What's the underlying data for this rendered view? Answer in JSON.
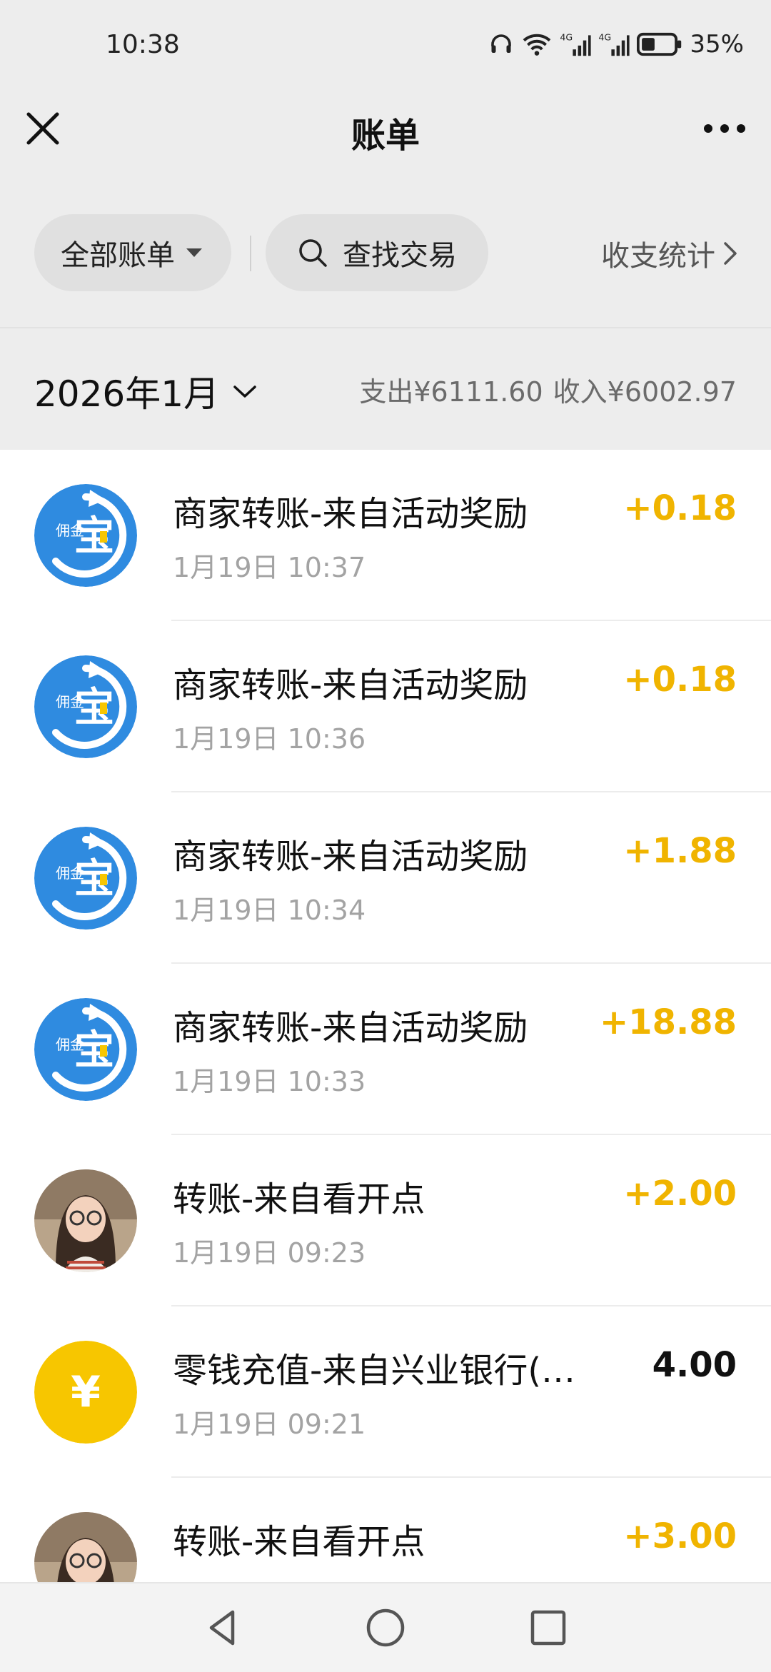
{
  "status_bar": {
    "time": "10:38",
    "battery": "35%"
  },
  "header": {
    "title": "账单"
  },
  "filters": {
    "all_bills": "全部账单",
    "search": "查找交易",
    "stats": "收支统计"
  },
  "month": {
    "label": "2026年1月",
    "expense": "支出¥6111.60",
    "income": "收入¥6002.97"
  },
  "transactions": [
    {
      "title": "商家转账-来自活动奖励",
      "time": "1月19日 10:37",
      "amount": "+0.18",
      "avatar": "yongjinbao-logo"
    },
    {
      "title": "商家转账-来自活动奖励",
      "time": "1月19日 10:36",
      "amount": "+0.18",
      "avatar": "yongjinbao-logo"
    },
    {
      "title": "商家转账-来自活动奖励",
      "time": "1月19日 10:34",
      "amount": "+1.88",
      "avatar": "yongjinbao-logo"
    },
    {
      "title": "商家转账-来自活动奖励",
      "time": "1月19日 10:33",
      "amount": "+18.88",
      "avatar": "yongjinbao-logo"
    },
    {
      "title": "转账-来自看开点",
      "time": "1月19日 09:23",
      "amount": "+2.00",
      "avatar": "user-avatar"
    },
    {
      "title": "零钱充值-来自兴业银行(…",
      "time": "1月19日 09:21",
      "amount": "4.00",
      "avatar": "yuan-coin-icon"
    },
    {
      "title": "转账-来自看开点",
      "time": "",
      "amount": "+3.00",
      "avatar": "user-avatar"
    }
  ],
  "logo_text": {
    "small": "佣金",
    "big": "宝"
  },
  "colors": {
    "income_amount": "#f0b400",
    "logo_blue": "#2f8be0",
    "coin_yellow": "#f7c600"
  }
}
